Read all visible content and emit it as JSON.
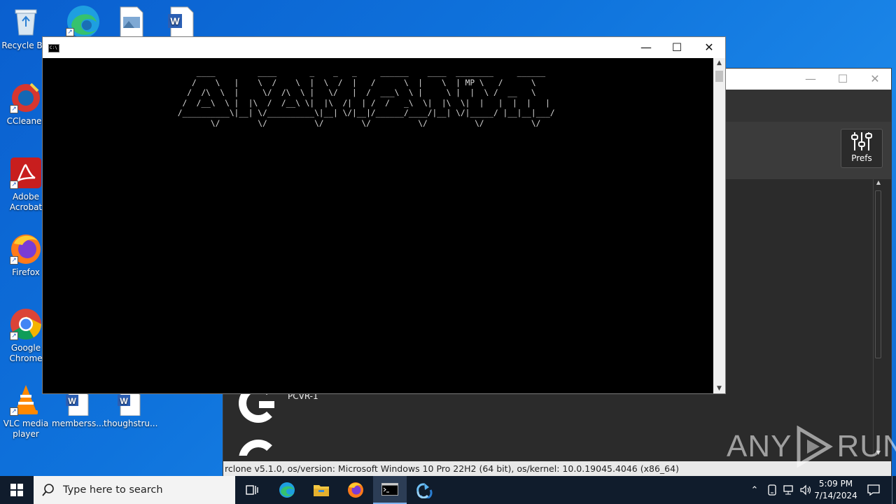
{
  "desktop": {
    "icons": [
      {
        "label": "Recycle Bin"
      },
      {
        "label": "CCleaner"
      },
      {
        "label": "Adobe Acrobat"
      },
      {
        "label": "Firefox"
      },
      {
        "label": "Google Chrome"
      },
      {
        "label": "VLC media player"
      },
      {
        "label": "memberss..."
      },
      {
        "label": "thoughstru..."
      }
    ]
  },
  "console": {
    "ascii_art": "     ____         ____       _    _   _     ______    ____  ________     ______ \n    /    \\   |    \\  /    \\  |  \\  /  |   /      \\  |    \\  | MP \\   /      \\\n   /  /\\  \\  |     \\/  /\\  \\ |   \\/   |  /  ___\\  \\ |     \\ |  |  \\ /  __   \\\n  /  /__\\  \\ |  |\\  /  /__\\ \\|  |\\  /|  | /  /   _\\  \\|  |\\  \\|  |   |  |  |   |\n /__________\\|__| \\/__________\\|__| \\/|__|/______/____/|__| \\/|_____/ |__|__|___/\n        \\/        \\/          \\/        \\/          \\/          \\/          \\/"
  },
  "rclone": {
    "prefs_label": "Prefs",
    "remote_name": "PCVR-1",
    "status_text": "rclone v5.1.0, os/version: Microsoft Windows 10 Pro 22H2 (64 bit), os/kernel: 10.0.19045.4046 (x86_64)"
  },
  "watermark": {
    "left": "ANY",
    "right": "RUN"
  },
  "taskbar": {
    "search_placeholder": "Type here to search",
    "time": "5:09 PM",
    "date": "7/14/2024"
  }
}
